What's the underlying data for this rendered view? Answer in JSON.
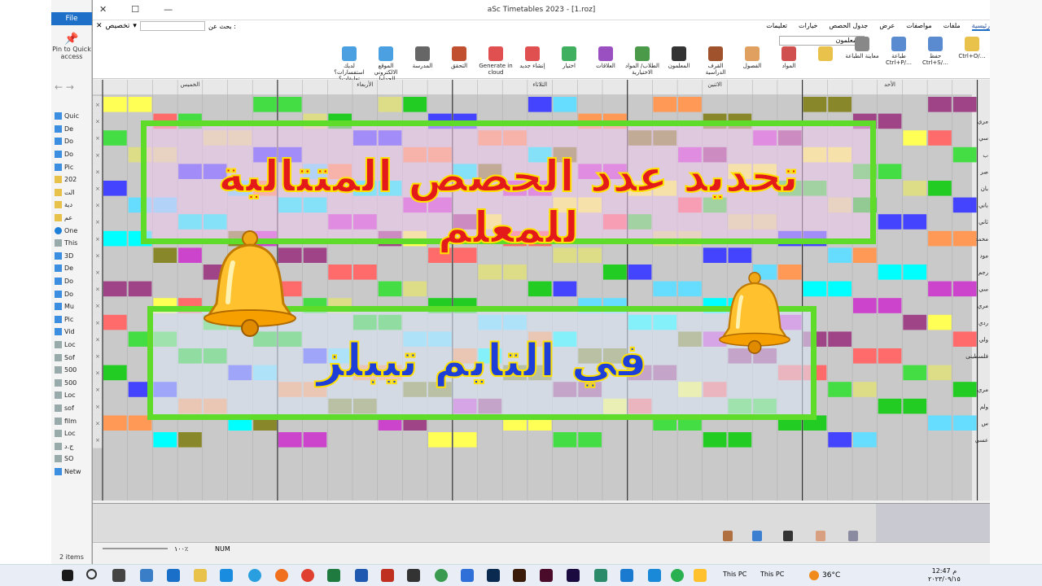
{
  "explorer": {
    "file_tab": "File",
    "pin_label": "Pin to Quick access",
    "nav_items": [
      "Quic",
      "De",
      "Do",
      "Do",
      "Pic",
      "202",
      "الت",
      "دية",
      "عم",
      "One",
      "This",
      "3D",
      "De",
      "Do",
      "Do",
      "Mu",
      "Pic",
      "Vid",
      "Loc",
      "Sof",
      "500",
      "500",
      "Loc",
      "sof",
      "film",
      "Loc",
      "ج.د",
      "SO",
      "Netw"
    ],
    "items_count": "2 items"
  },
  "window": {
    "title": "aSc Timetables 2023  -  [1.roz]",
    "search_label": "بحث عن :",
    "customize_label": "تخصيص",
    "tabs": [
      "رئيسية",
      "ملفات",
      "مواصفات",
      "عرض",
      "جدول الحصص",
      "خيارات",
      "تعليمات"
    ],
    "teacher_select": "المعلمون"
  },
  "ribbon": {
    "buttons": [
      "Ctrl+O/…",
      "حفظ\nCtrl+S/…",
      "طباعة\nCtrl+P/…",
      "معاينة الطباعة",
      "",
      "المواد",
      "الفصول",
      "القرف الدراسية",
      "المعلمون",
      "الطلاب/ المواد الاختيارية",
      "العلاقات",
      "اختيار",
      "إنشاء جديد",
      "Generate in cloud",
      "التحقق",
      "المدرسة",
      "الموقع الالكتروني للجداول المدرسية",
      "لديك استفسارات؟ تعليقات؟ يمكنك مراسلتنا"
    ]
  },
  "grid": {
    "day_headers": [
      "الخميس",
      "الأربعاء",
      "الثلاثاء",
      "الاثنين",
      "الأحد"
    ],
    "row_labels": [
      "",
      "مري",
      "سي",
      "ب",
      "صر",
      "بان",
      "باني",
      "ثاني",
      "محمد",
      "مود",
      "رجم",
      "سي",
      "مري",
      "ردي",
      "ولي",
      "فلسطينى",
      "",
      "مري",
      "ولم",
      "س",
      "عسي"
    ]
  },
  "overlay": {
    "line1": "تحديد عدد الحصص المتتالية للمعلم",
    "line2": "في التايم تيبلز"
  },
  "status": {
    "zoom": "١٠٠٪",
    "num": "NUM"
  },
  "taskbar": {
    "thispc1": "This PC",
    "thispc2": "This PC",
    "temperature": "36°C",
    "time": "12:47 م",
    "date": "٢٠٢٣/٠٩/١٥"
  },
  "colors": {
    "accent": "#1e6fc8",
    "overlay_border": "#5fdc2a",
    "overlay_title_red": "#e41a1a",
    "overlay_title_blue": "#1d3fd8"
  }
}
